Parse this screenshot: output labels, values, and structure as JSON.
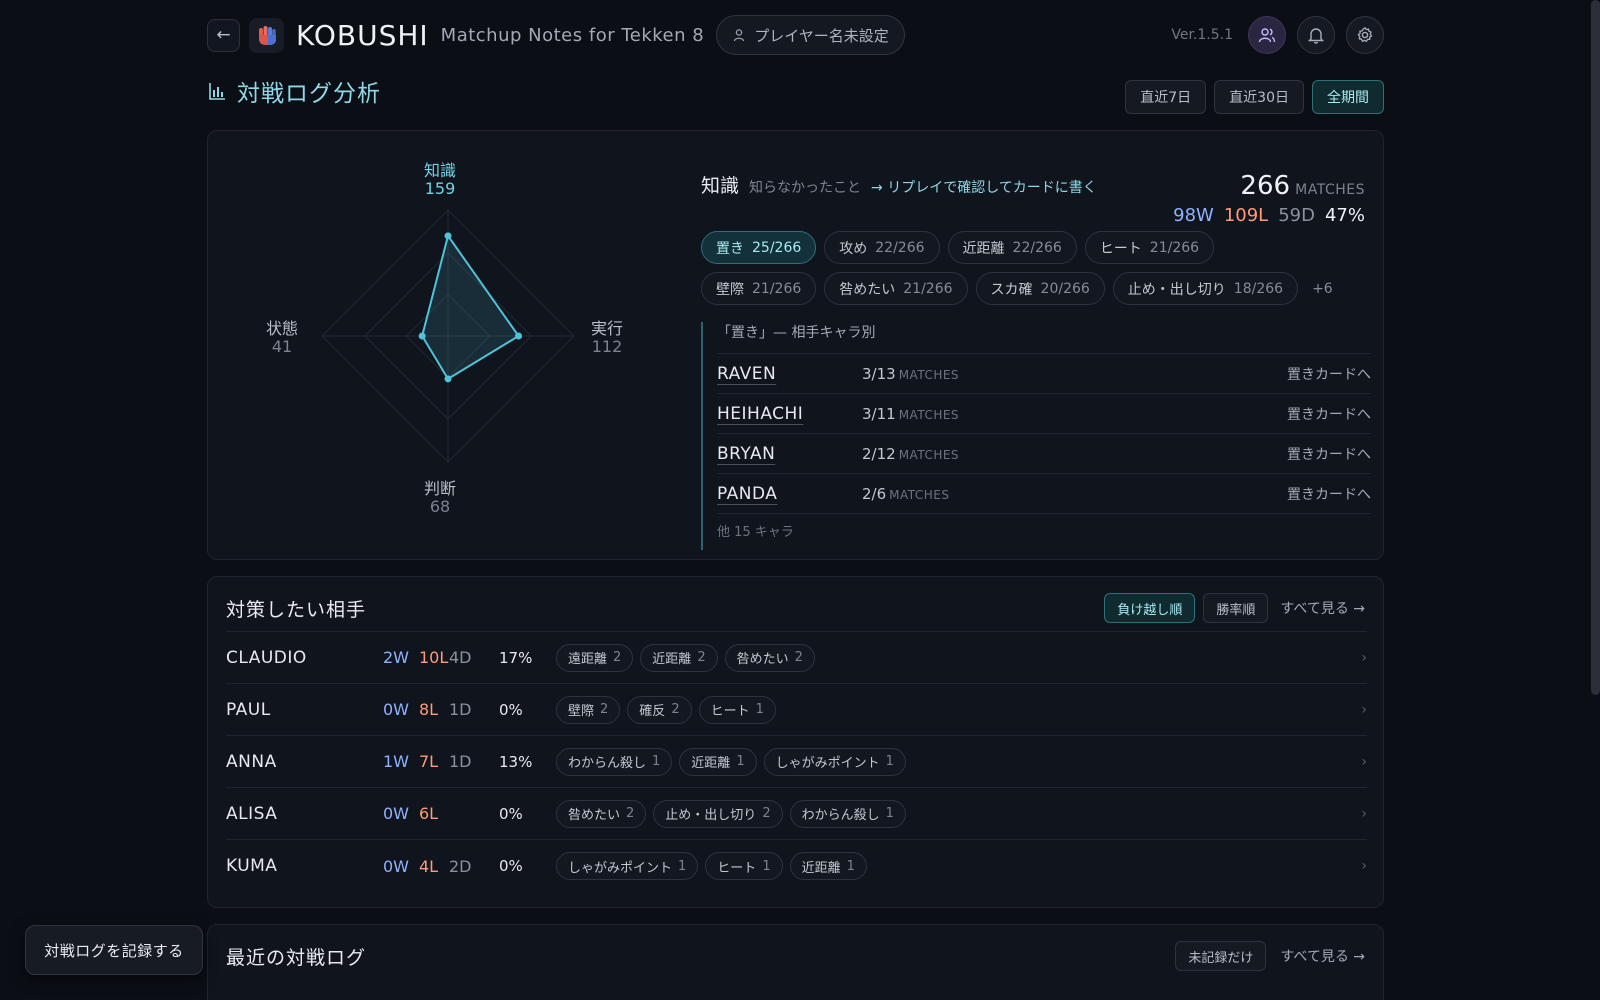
{
  "app": {
    "name": "KOBUSHI",
    "subtitle": "Matchup Notes for Tekken 8",
    "player_button": "プレイヤー名未設定",
    "version": "Ver.1.5.1"
  },
  "page": {
    "title": "対戦ログ分析",
    "ranges": [
      "直近7日",
      "直近30日",
      "全期間"
    ],
    "active_range": 2
  },
  "radar": {
    "axes": [
      {
        "label": "知識",
        "value": "159"
      },
      {
        "label": "実行",
        "value": "112"
      },
      {
        "label": "判断",
        "value": "68"
      },
      {
        "label": "状態",
        "value": "41"
      }
    ],
    "max": 200,
    "accent": "#4fc3d9"
  },
  "analysis": {
    "category_name": "知識",
    "category_desc": "知らなかったこと",
    "category_link": "→ リプレイで確認してカードに書く",
    "total_matches": "266",
    "matches_unit": "MATCHES",
    "wins": "98W",
    "losses": "109L",
    "draws": "59D",
    "win_rate": "47%",
    "chips_row1": [
      {
        "label": "置き",
        "count": "25/266",
        "active": true
      },
      {
        "label": "攻め",
        "count": "22/266"
      },
      {
        "label": "近距離",
        "count": "22/266"
      },
      {
        "label": "ヒート",
        "count": "21/266"
      }
    ],
    "chips_row2": [
      {
        "label": "壁際",
        "count": "21/266"
      },
      {
        "label": "咎めたい",
        "count": "21/266"
      },
      {
        "label": "スカ確",
        "count": "20/266"
      },
      {
        "label": "止め・出し切り",
        "count": "18/266"
      }
    ],
    "chips_more": "+6",
    "breakdown_title": "「置き」— 相手キャラ別",
    "breakdown": [
      {
        "character": "RAVEN",
        "count": "3/13",
        "unit": "MATCHES",
        "action": "置きカードへ"
      },
      {
        "character": "HEIHACHI",
        "count": "3/11",
        "unit": "MATCHES",
        "action": "置きカードへ"
      },
      {
        "character": "BRYAN",
        "count": "2/12",
        "unit": "MATCHES",
        "action": "置きカードへ"
      },
      {
        "character": "PANDA",
        "count": "2/6",
        "unit": "MATCHES",
        "action": "置きカードへ"
      }
    ],
    "breakdown_footer": "他 15 キャラ"
  },
  "opponents": {
    "title": "対策したい相手",
    "sort_options": [
      "負け越し順",
      "勝率順"
    ],
    "active_sort": 0,
    "see_all": "すべて見る →",
    "rows": [
      {
        "name": "CLAUDIO",
        "w": "2W",
        "l": "10L",
        "d": "4D",
        "rate": "17%",
        "tags": [
          [
            "遠距離",
            "2"
          ],
          [
            "近距離",
            "2"
          ],
          [
            "咎めたい",
            "2"
          ]
        ]
      },
      {
        "name": "PAUL",
        "w": "0W",
        "l": "8L",
        "d": "1D",
        "rate": "0%",
        "tags": [
          [
            "壁際",
            "2"
          ],
          [
            "確反",
            "2"
          ],
          [
            "ヒート",
            "1"
          ]
        ]
      },
      {
        "name": "ANNA",
        "w": "1W",
        "l": "7L",
        "d": "1D",
        "rate": "13%",
        "tags": [
          [
            "わからん殺し",
            "1"
          ],
          [
            "近距離",
            "1"
          ],
          [
            "しゃがみポイント",
            "1"
          ]
        ]
      },
      {
        "name": "ALISA",
        "w": "0W",
        "l": "6L",
        "d": "",
        "rate": "0%",
        "tags": [
          [
            "咎めたい",
            "2"
          ],
          [
            "止め・出し切り",
            "2"
          ],
          [
            "わからん殺し",
            "1"
          ]
        ]
      },
      {
        "name": "KUMA",
        "w": "0W",
        "l": "4L",
        "d": "2D",
        "rate": "0%",
        "tags": [
          [
            "しゃがみポイント",
            "1"
          ],
          [
            "ヒート",
            "1"
          ],
          [
            "近距離",
            "1"
          ]
        ]
      }
    ]
  },
  "recent": {
    "title": "最近の対戦ログ",
    "filter_button": "未記録だけ",
    "see_all": "すべて見る →"
  },
  "record_button": "対戦ログを記録する"
}
